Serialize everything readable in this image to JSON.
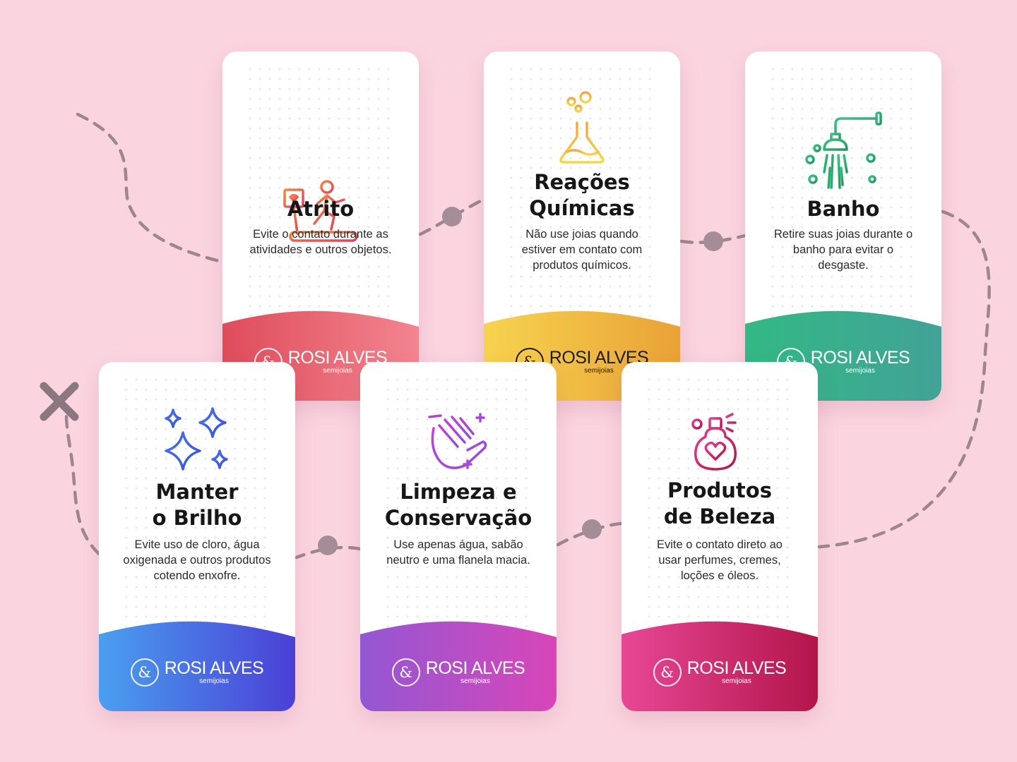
{
  "brand": {
    "name": "ROSI ALVES",
    "tagline": "semijoias",
    "monogram": "&"
  },
  "colors": {
    "background": "#fad5e0",
    "path": "#9c8790",
    "x_mark": "#8a7780"
  },
  "cards": [
    {
      "icon": "treadmill-runner-icon",
      "title_lines": [
        "Atrito"
      ],
      "desc": "Evite o contato durante as atividades e outros objetos.",
      "gradient": [
        "#df4c5a",
        "#f28590"
      ]
    },
    {
      "icon": "chemistry-flask-icon",
      "title_lines": [
        "Reações",
        "Químicas"
      ],
      "desc": "Não use joias quando estiver em contato com produtos químicos.",
      "gradient": [
        "#f7d34f",
        "#e9a237"
      ]
    },
    {
      "icon": "shower-icon",
      "title_lines": [
        "Banho"
      ],
      "desc": "Retire suas joias durante o banho para evitar o desgaste.",
      "gradient": [
        "#32b984",
        "#42a297"
      ]
    },
    {
      "icon": "sparkles-icon",
      "title_lines": [
        "Manter",
        "o Brilho"
      ],
      "desc": "Evite uso de cloro, água oxigenada e outros produtos cotendo enxofre.",
      "gradient": [
        "#4a9ff0",
        "#4b3fd6"
      ]
    },
    {
      "icon": "washing-hands-icon",
      "title_lines": [
        "Limpeza e",
        "Conservação"
      ],
      "desc": "Use apenas água, sabão neutro e uma flanela macia.",
      "gradient": [
        "#9357d3",
        "#d846b8"
      ]
    },
    {
      "icon": "perfume-bottle-icon",
      "title_lines": [
        "Produtos",
        "de Beleza"
      ],
      "desc": "Evite o contato direto ao usar perfumes, cremes, loções e óleos.",
      "gradient": [
        "#e84796",
        "#b3154a"
      ]
    }
  ]
}
